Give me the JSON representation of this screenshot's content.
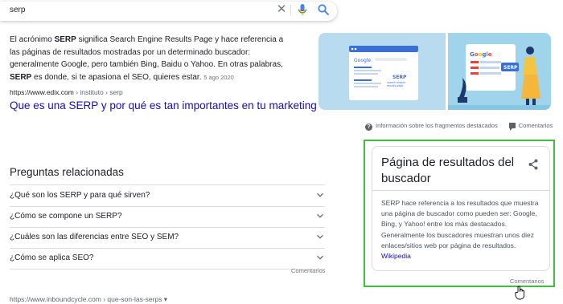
{
  "search": {
    "query": "serp"
  },
  "snippet": {
    "part1": "El acrónimo ",
    "bold1": "SERP",
    "part2": " significa Search Engine Results Page y hace referencia a las páginas de resultados mostradas por un determinado buscador: generalmente Google, pero también Bing, Baidu o Yahoo. En otras palabras, ",
    "bold2": "SERP",
    "part3": " es donde, si te apasiona el SEO, quieres estar.",
    "date": "5 ago 2020",
    "cite_domain": "https://www.edix.com",
    "cite_path": " › instituto › serp",
    "title": "Que es una SERP y por qué es tan importantes en tu marketing",
    "image_texts": {
      "google": "Google",
      "serp": "SERP",
      "serp_sub": "search engine results page"
    }
  },
  "about_bar": {
    "about": "Información sobre los fragmentos destacados",
    "feedback": "Comentarios"
  },
  "paa": {
    "heading": "Preguntas relacionadas",
    "questions": [
      "¿Qué son los SERP y para qué sirven?",
      "¿Cómo se compone un SERP?",
      "¿Cuáles son las diferencias entre SEO y SEM?",
      "¿Cómo se aplica SEO?"
    ],
    "feedback": "Comentarios"
  },
  "next_result": {
    "cite": "https://www.inboundcycle.com › que-son-las-serps ▾"
  },
  "knowledge_panel": {
    "title": "Página de resultados del buscador",
    "description": "SERP hace referencia a los resultados que muestra una página de buscador como pueden ser: Google, Bing, y Yahoo! entre los más destacados. Generalmente los buscadores muestran unos diez enlaces/sitios web por página de resultados.",
    "source": "Wikipedia",
    "feedback": "Comentarios",
    "outline_color": "#3fbf3f"
  },
  "colors": {
    "link": "#1a0dab",
    "text": "#202124",
    "muted": "#70757a",
    "google_blue": "#4285f4"
  }
}
